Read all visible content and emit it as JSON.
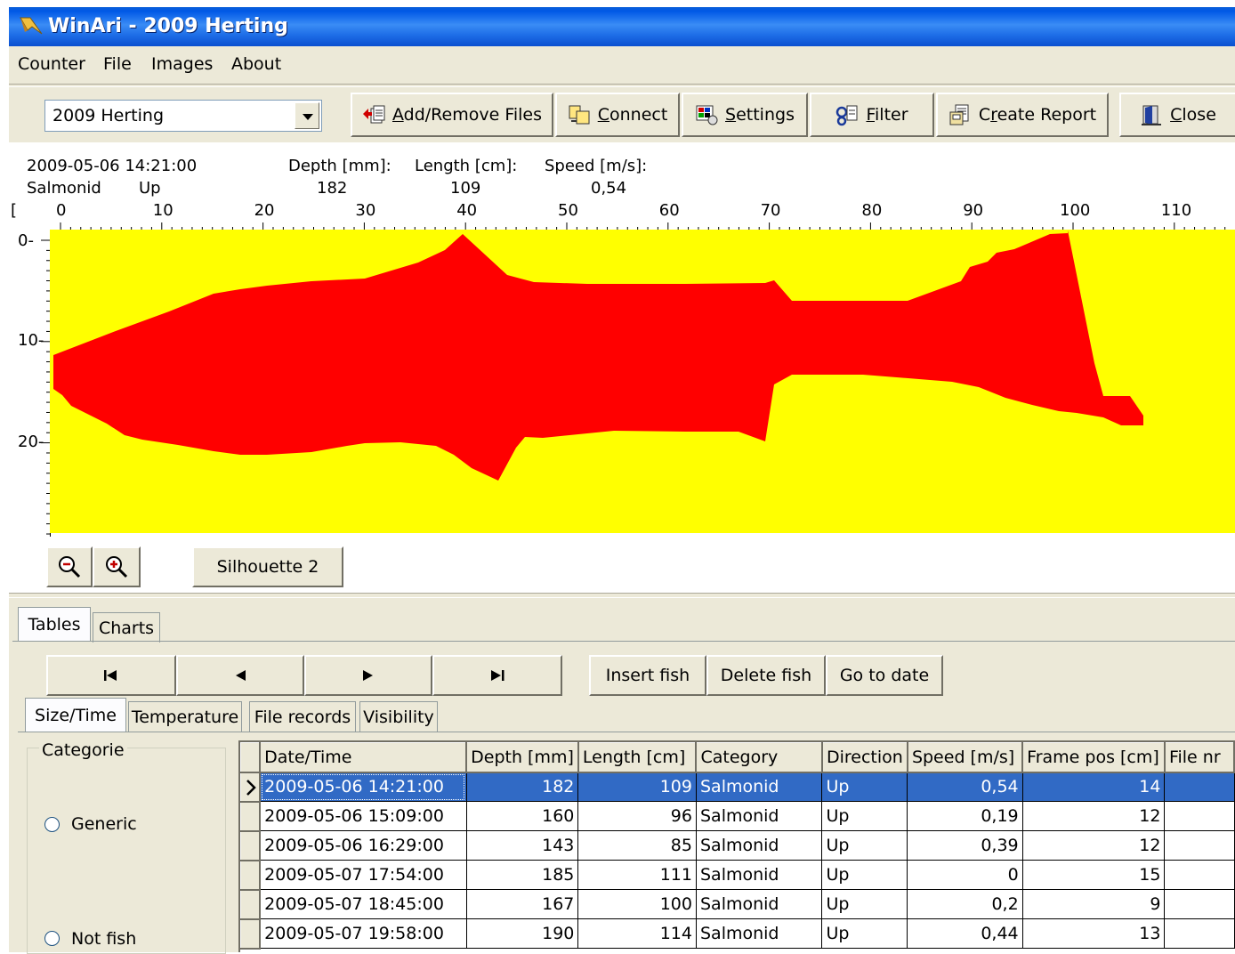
{
  "window": {
    "title": "WinAri - 2009 Herting"
  },
  "menu": [
    "Counter",
    "File",
    "Images",
    "About"
  ],
  "toolbar": {
    "dataset": "2009 Herting",
    "buttons": [
      {
        "label_u": "A",
        "label_rest": "dd/Remove Files",
        "icon": "add-remove-files-icon"
      },
      {
        "label_u": "C",
        "label_rest": "onnect",
        "icon": "connect-icon"
      },
      {
        "label_u": "S",
        "label_rest": "ettings",
        "icon": "settings-icon"
      },
      {
        "label_u": "F",
        "label_rest": "ilter",
        "icon": "filter-icon"
      },
      {
        "label_pre": "C",
        "label_u": "r",
        "label_rest": "eate Report",
        "icon": "report-icon"
      },
      {
        "label_u": "C",
        "label_rest": "lose",
        "icon": "close-door-icon"
      }
    ]
  },
  "fish_info": {
    "datetime": "2009-05-06 14:21:00",
    "category": "Salmonid",
    "direction": "Up",
    "depth_label": "Depth [mm]:",
    "depth_value": "182",
    "length_label": "Length [cm]:",
    "length_value": "109",
    "speed_label": "Speed [m/s]:",
    "speed_value": "0,54"
  },
  "ruler": {
    "start_bracket": "[",
    "x_ticks": [
      "0",
      "10",
      "20",
      "30",
      "40",
      "50",
      "60",
      "70",
      "80",
      "90",
      "100",
      "110"
    ],
    "y_ticks": [
      "0-",
      "10-",
      "20-"
    ]
  },
  "silhouette": {
    "background": "#ffff00",
    "fill": "#ff0000",
    "button_label": "Silhouette 2"
  },
  "tabs_main": [
    "Tables",
    "Charts"
  ],
  "nav": {
    "first": "⏮",
    "prev": "◀",
    "next": "▶",
    "last": "⏭",
    "insert": "Insert fish",
    "delete": "Delete fish",
    "goto": "Go to date"
  },
  "tabs_sub": [
    "Size/Time",
    "Temperature",
    "File records",
    "Visibility"
  ],
  "categorie": {
    "title": "Categorie",
    "options": [
      "Generic",
      "Not fish"
    ]
  },
  "table": {
    "columns": [
      "Date/Time",
      "Depth [mm]",
      "Length [cm]",
      "Category",
      "Direction",
      "Speed [m/s]",
      "Frame pos [cm]",
      "File nr"
    ],
    "rows": [
      [
        "2009-05-06 14:21:00",
        "182",
        "109",
        "Salmonid",
        "Up",
        "0,54",
        "14",
        ""
      ],
      [
        "2009-05-06 15:09:00",
        "160",
        "96",
        "Salmonid",
        "Up",
        "0,19",
        "12",
        ""
      ],
      [
        "2009-05-06 16:29:00",
        "143",
        "85",
        "Salmonid",
        "Up",
        "0,39",
        "12",
        ""
      ],
      [
        "2009-05-07 17:54:00",
        "185",
        "111",
        "Salmonid",
        "Up",
        "0",
        "15",
        ""
      ],
      [
        "2009-05-07 18:45:00",
        "167",
        "100",
        "Salmonid",
        "Up",
        "0,2",
        "9",
        ""
      ],
      [
        "2009-05-07 19:58:00",
        "190",
        "114",
        "Salmonid",
        "Up",
        "0,44",
        "13",
        ""
      ]
    ],
    "selected_row": 0
  }
}
